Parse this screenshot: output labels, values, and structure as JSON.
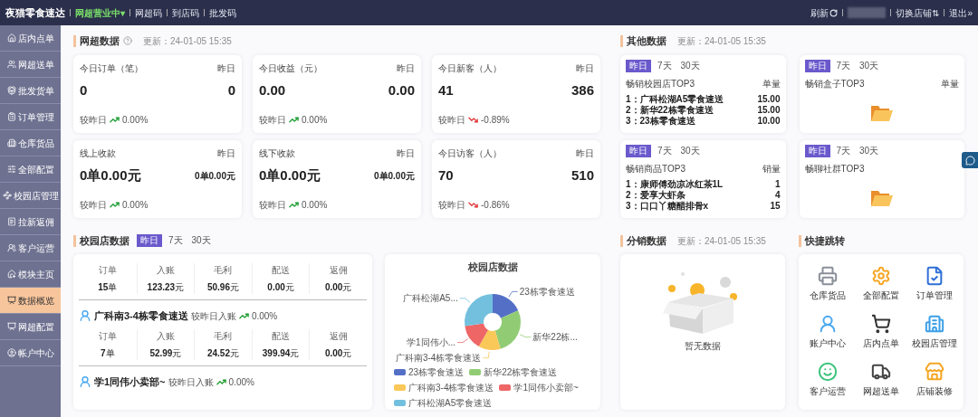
{
  "top_bar": {
    "brand": "夜猫零食速达",
    "status": "网超营业中▾",
    "links": [
      "网超码",
      "到店码",
      "批发码"
    ],
    "refresh": "刷新",
    "switch_store": "切换店铺⇅",
    "logout": "退出»"
  },
  "sidebar": {
    "items": [
      {
        "label": "店内点单",
        "selected": false
      },
      {
        "label": "网超送单",
        "selected": false
      },
      {
        "label": "批发货单",
        "selected": false
      },
      {
        "label": "订单管理",
        "selected": false
      },
      {
        "label": "仓库货品",
        "selected": false
      },
      {
        "label": "全部配置",
        "selected": false
      },
      {
        "label": "校园店管理",
        "selected": false
      },
      {
        "label": "拉新返佣",
        "selected": false
      },
      {
        "label": "客户运营",
        "selected": false
      },
      {
        "label": "模块主页",
        "selected": false
      },
      {
        "label": "数据概览",
        "selected": true
      },
      {
        "label": "网超配置",
        "selected": false
      },
      {
        "label": "帐户中心",
        "selected": false
      }
    ]
  },
  "network_data": {
    "title": "网超数据",
    "updated": "更新：24-01-05 15:35",
    "cards": [
      {
        "title": "今日订单（笔）",
        "yesterday_label": "昨日",
        "value": "0",
        "yesterday_value": "0",
        "compare_label": "较昨日",
        "kind": "up",
        "change": "0.00%"
      },
      {
        "title": "今日收益（元）",
        "yesterday_label": "昨日",
        "value": "0.00",
        "yesterday_value": "0.00",
        "compare_label": "较昨日",
        "kind": "up",
        "change": "0.00%"
      },
      {
        "title": "今日新客（人）",
        "yesterday_label": "昨日",
        "value": "41",
        "yesterday_value": "386",
        "compare_label": "较昨日",
        "kind": "down",
        "change": "-0.89%"
      },
      {
        "title": "线上收款",
        "yesterday_label": "昨日",
        "value": "0单0.00元",
        "yesterday_value": "0单0.00元",
        "compare_label": "较昨日",
        "kind": "up",
        "change": "0.00%"
      },
      {
        "title": "线下收款",
        "yesterday_label": "昨日",
        "value": "0单0.00元",
        "yesterday_value": "0单0.00元",
        "compare_label": "较昨日",
        "kind": "up",
        "change": "0.00%"
      },
      {
        "title": "今日访客（人）",
        "yesterday_label": "昨日",
        "value": "70",
        "yesterday_value": "510",
        "compare_label": "较昨日",
        "kind": "down",
        "change": "-0.86%"
      }
    ]
  },
  "campus_data": {
    "title": "校园店数据",
    "periods": [
      {
        "label": "昨日",
        "selected": true
      },
      {
        "label": "7天",
        "selected": false
      },
      {
        "label": "30天",
        "selected": false
      }
    ],
    "stores": [
      {
        "stats": [
          {
            "label": "订单",
            "value": "15",
            "unit": "单"
          },
          {
            "label": "入账",
            "value": "123.23",
            "unit": "元"
          },
          {
            "label": "毛利",
            "value": "50.96",
            "unit": "元"
          },
          {
            "label": "配送",
            "value": "0.00",
            "unit": "元"
          },
          {
            "label": "返佣",
            "value": "0.00",
            "unit": "元"
          }
        ]
      },
      {
        "name": "广科南3-4栋零食速送",
        "compare_label": "较昨日入账",
        "kind": "up",
        "change": "0.00%",
        "stats": [
          {
            "label": "订单",
            "value": "7",
            "unit": "单"
          },
          {
            "label": "入账",
            "value": "52.99",
            "unit": "元"
          },
          {
            "label": "毛利",
            "value": "24.52",
            "unit": "元"
          },
          {
            "label": "配送",
            "value": "399.94",
            "unit": "元"
          },
          {
            "label": "返佣",
            "value": "0.00",
            "unit": "元"
          }
        ]
      },
      {
        "name": "学1同伟小卖部~",
        "compare_label": "较昨日入账",
        "kind": "up",
        "change": "0.00%"
      }
    ],
    "chart_data": {
      "type": "donut",
      "title": "校园店数据",
      "categories": [
        "23栋零食速送",
        "新华22栋零食速送",
        "广科南3-4栋零食速送",
        "学1同伟小卖部~",
        "广科松湖A5零食速送"
      ],
      "values": [
        18.2,
        27.3,
        12.7,
        14.5,
        27.3
      ],
      "colors": [
        "#5470c6",
        "#91cc75",
        "#fac858",
        "#ee6666",
        "#73c0de"
      ],
      "annotations": [
        "23栋零食速送",
        "新华22栋...",
        "广科南3-4栋零食速送",
        "学1同伟小...",
        "广科松湖A5..."
      ]
    }
  },
  "other_data": {
    "title": "其他数据",
    "updated": "更新：24-01-05 15:35",
    "cards": [
      {
        "periods": [
          {
            "label": "昨日",
            "selected": true
          },
          {
            "label": "7天",
            "selected": false
          },
          {
            "label": "30天",
            "selected": false
          }
        ],
        "title": "畅销校园店TOP3",
        "column": "单量",
        "items": [
          {
            "rank": "1：",
            "name": "广科松湖A5零食速送",
            "value": "15.00"
          },
          {
            "rank": "2：",
            "name": "新华22栋零食速送",
            "value": "15.00"
          },
          {
            "rank": "3：",
            "name": "23栋零食速送",
            "value": "10.00"
          }
        ]
      },
      {
        "periods": [
          {
            "label": "昨日",
            "selected": true
          },
          {
            "label": "7天",
            "selected": false
          },
          {
            "label": "30天",
            "selected": false
          }
        ],
        "title": "畅销盒子TOP3",
        "column": "单量"
      },
      {
        "periods": [
          {
            "label": "昨日",
            "selected": true
          },
          {
            "label": "7天",
            "selected": false
          },
          {
            "label": "30天",
            "selected": false
          }
        ],
        "title": "畅销商品TOP3",
        "column": "销量",
        "items": [
          {
            "rank": "1：",
            "name": "康师傅劲凉冰红茶1L",
            "value": "1"
          },
          {
            "rank": "2：",
            "name": "爱享大虾条",
            "value": "4"
          },
          {
            "rank": "3：",
            "name": "口口丫糖醋排骨x",
            "value": "15"
          }
        ]
      },
      {
        "periods": [
          {
            "label": "昨日",
            "selected": true
          },
          {
            "label": "7天",
            "selected": false
          },
          {
            "label": "30天",
            "selected": false
          }
        ],
        "title": "畅聊社群TOP3"
      }
    ]
  },
  "distribution": {
    "title": "分销数据",
    "updated": "更新：24-01-05 15:35",
    "empty_text": "暂无数据"
  },
  "shortcuts": {
    "title": "快捷跳转",
    "items": [
      {
        "label": "仓库货品"
      },
      {
        "label": "全部配置"
      },
      {
        "label": "订单管理"
      },
      {
        "label": "账户中心"
      },
      {
        "label": "店内点单"
      },
      {
        "label": "校园店管理"
      },
      {
        "label": "客户运营"
      },
      {
        "label": "网超送单"
      },
      {
        "label": "店铺装修"
      }
    ]
  }
}
